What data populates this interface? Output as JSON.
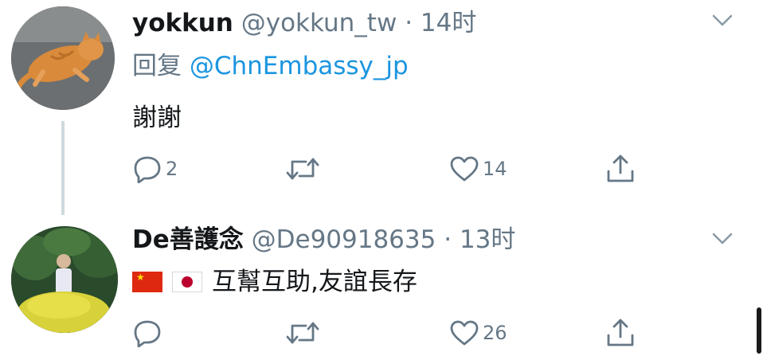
{
  "tweets": [
    {
      "display_name": "yokkun",
      "handle": "@yokkun_tw",
      "separator": "·",
      "time": "14时",
      "reply_prefix": "回复",
      "reply_to": "@ChnEmbassy_jp",
      "text": "謝謝",
      "reply_count": "2",
      "retweet_count": "",
      "like_count": "14"
    },
    {
      "display_name": "De善護念",
      "handle": "@De90918635",
      "separator": "·",
      "time": "13时",
      "flags": [
        "china-flag",
        "japan-flag"
      ],
      "text": "互幫互助,友誼長存",
      "reply_count": "",
      "retweet_count": "",
      "like_count": "26"
    }
  ],
  "icons": {
    "reply": "reply-icon",
    "retweet": "retweet-icon",
    "like": "like-icon",
    "share": "share-icon",
    "menu": "chevron-down-icon"
  },
  "colors": {
    "text": "#14171a",
    "secondary": "#657786",
    "mention": "#1b95e0",
    "thread_line": "#cfd9de"
  }
}
